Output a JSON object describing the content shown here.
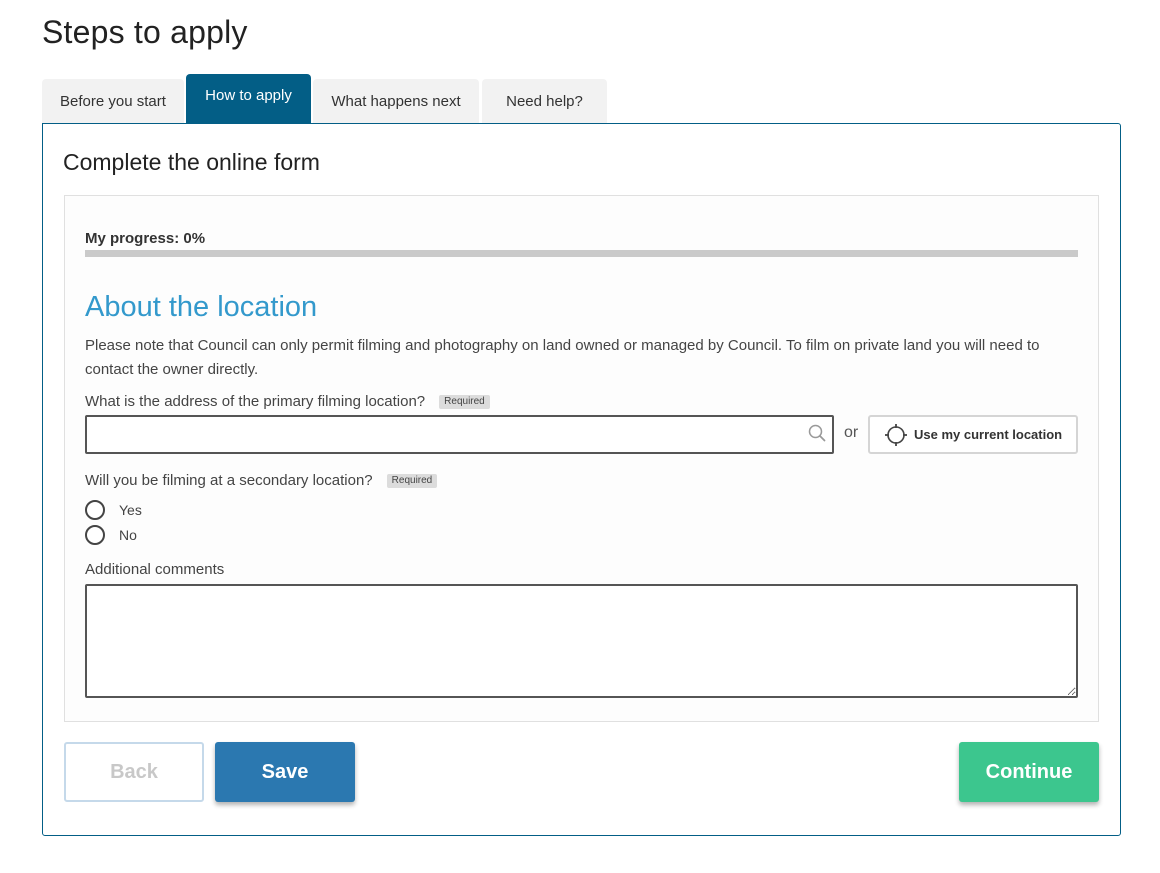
{
  "page": {
    "title": "Steps to apply"
  },
  "tabs": [
    {
      "label": "Before you start",
      "active": false
    },
    {
      "label": "How to apply",
      "active": true
    },
    {
      "label": "What happens next",
      "active": false
    },
    {
      "label": "Need help?",
      "active": false
    }
  ],
  "panel": {
    "title": "Complete the online form"
  },
  "progress": {
    "label": "My progress: 0%",
    "value_percent": 0
  },
  "section": {
    "title": "About the location",
    "note": "Please note that Council can only permit filming and photography on land owned or managed by Council. To film on private land you will need to contact the owner directly."
  },
  "fields": {
    "address": {
      "label": "What is the address of the primary filming location?",
      "badge": "Required",
      "value": "",
      "placeholder": "",
      "icon": "search-icon"
    },
    "or_text": "or",
    "location_button": {
      "label": "Use my current location",
      "icon": "crosshair-icon"
    },
    "secondary": {
      "label": "Will you be filming at a secondary location?",
      "badge": "Required",
      "options": [
        {
          "label": "Yes",
          "checked": false
        },
        {
          "label": "No",
          "checked": false
        }
      ]
    },
    "comments": {
      "label": "Additional comments",
      "value": ""
    }
  },
  "buttons": {
    "back": "Back",
    "save": "Save",
    "continue": "Continue"
  },
  "colors": {
    "tab_active": "#035e86",
    "heading_accent": "#3399cc",
    "save": "#2b78b0",
    "continue": "#3cc68e",
    "progress_track": "#cacaca"
  }
}
